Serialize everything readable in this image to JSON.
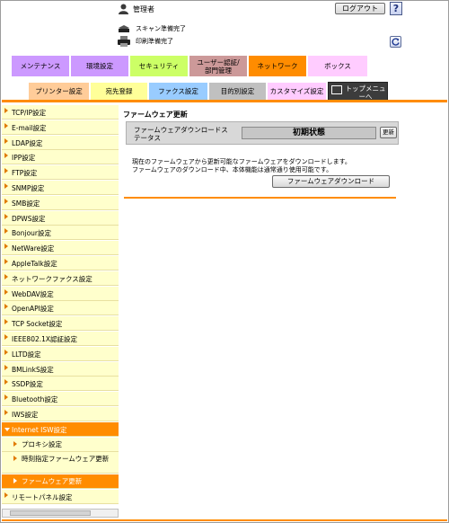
{
  "header": {
    "user_label": "管理者",
    "logout_label": "ログアウト",
    "help_label": "?",
    "scan_status": "スキャン準備完了",
    "print_status": "印刷準備完了"
  },
  "tabs_row1": [
    {
      "label": "メンテナンス",
      "color": "#cc99ff"
    },
    {
      "label": "環境設定",
      "color": "#cc99ff"
    },
    {
      "label": "セキュリティ",
      "color": "#ccff66"
    },
    {
      "label": "ユーザー認証/部門管理",
      "color": "#cc9999"
    },
    {
      "label": "ネットワーク",
      "color": "#ff8c00"
    },
    {
      "label": "ボックス",
      "color": "#ffccff"
    }
  ],
  "tabs_row2": [
    {
      "label": "プリンター設定",
      "color": "#ffcc99"
    },
    {
      "label": "宛先登録",
      "color": "#ffff99"
    },
    {
      "label": "ファクス設定",
      "color": "#99ccff"
    },
    {
      "label": "目的別設定",
      "color": "#c0c0c0"
    },
    {
      "label": "カスタマイズ設定",
      "color": "#ffccff"
    }
  ],
  "top_menu_label": "トップメニューへ",
  "sidebar": {
    "items": [
      "TCP/IP設定",
      "E-mail設定",
      "LDAP設定",
      "IPP設定",
      "FTP設定",
      "SNMP設定",
      "SMB設定",
      "DPWS設定",
      "Bonjour設定",
      "NetWare設定",
      "AppleTalk設定",
      "ネットワークファクス設定",
      "WebDAV設定",
      "OpenAPI設定",
      "TCP Socket設定",
      "IEEE802.1X認証設定",
      "LLTD設定",
      "BMLinkS設定",
      "SSDP設定",
      "Bluetooth設定",
      "IWS設定"
    ],
    "active_item": "Internet ISW設定",
    "sub_items": [
      "プロキシ設定",
      "時刻指定ファームウェア更新",
      "ファームウェア更新"
    ],
    "last_item": "リモートパネル設定"
  },
  "main": {
    "title": "ファームウェア更新",
    "fw_status_label": "ファームウェアダウンロードステータス",
    "fw_status_value": "初期状態",
    "update_button": "更新",
    "desc_line1": "現在のファームウェアから更新可能なファームウェアをダウンロードします。",
    "desc_line2": "ファームウェアのダウンロード中、本体機能は通常通り使用可能です。",
    "download_button": "ファームウェアダウンロード"
  }
}
